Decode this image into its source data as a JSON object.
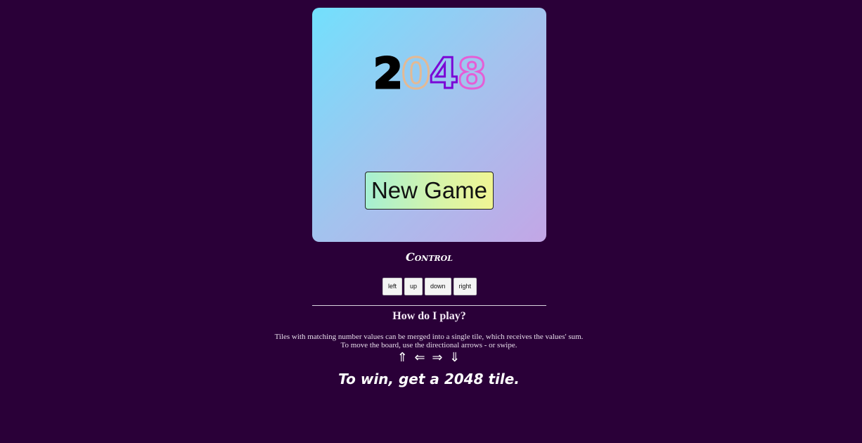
{
  "game": {
    "logo_digits": [
      "2",
      "0",
      "4",
      "8"
    ],
    "new_game_label": "New Game",
    "colors": {
      "background": "#2a0038",
      "board_gradient": [
        "#72e0fd",
        "#c3a6e6"
      ],
      "digit_colors": [
        "#000000",
        "#e3b994",
        "#7a07d6",
        "#e55ed6"
      ]
    }
  },
  "controls": {
    "title": "Control",
    "buttons": [
      "left",
      "up",
      "down",
      "right"
    ]
  },
  "help": {
    "title": "How do I play?",
    "line1": "Tiles with matching number values can be merged into a single tile, which receives the values' sum.",
    "line2": "To move the board, use the directional arrows - or swipe.",
    "arrows": "⇑ ⇐ ⇒ ⇓",
    "win_text": "To win, get a 2048 tile."
  }
}
